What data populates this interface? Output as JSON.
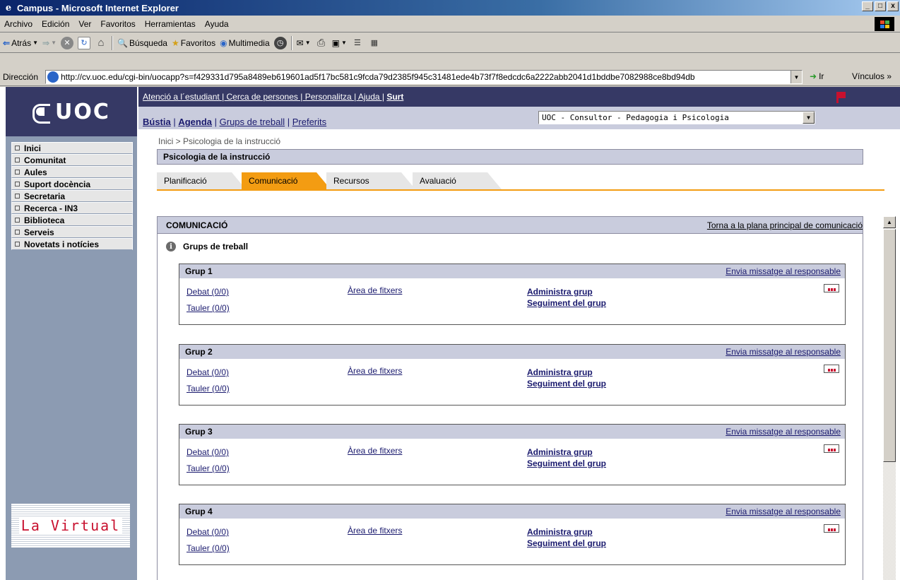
{
  "window": {
    "title": "Campus - Microsoft Internet Explorer",
    "controls": [
      "_",
      "□",
      "x"
    ]
  },
  "menu": [
    "Archivo",
    "Edición",
    "Ver",
    "Favoritos",
    "Herramientas",
    "Ayuda"
  ],
  "toolbar": {
    "back": "Atrás",
    "search": "Búsqueda",
    "favorites": "Favoritos",
    "multimedia": "Multimedia"
  },
  "address": {
    "label": "Dirección",
    "url": "http://cv.uoc.edu/cgi-bin/uocapp?s=f429331d795a8489eb619601ad5f17bc581c9fcda79d2385f945c31481ede4b73f7f8edcdc6a2222abb2041d1bddbe7082988ce8bd94db",
    "go": "Ir",
    "links": "Vínculos"
  },
  "site": {
    "logo": "UOC",
    "top_links": "Atenció a l´estudiant | Cerca de persones | Personalitza | Ajuda |",
    "top_exit": "Surt",
    "sub_bustia": "Bústia",
    "sub_agenda": "Agenda",
    "sub_grups": "Grups de treball",
    "sub_preferits": "Preferits",
    "consultor": "UOC - Consultor - Pedagogia i Psicologia",
    "nav": [
      "Inici",
      "Comunitat",
      "Aules",
      "Suport docència",
      "Secretaria",
      "Recerca - IN3",
      "Biblioteca",
      "Serveis",
      "Novetats i notícies"
    ],
    "lavirtual": "La Virtual"
  },
  "content": {
    "breadcrumb": "Inici  > Psicologia de la instrucció",
    "course_title": "Psicologia de la instrucció",
    "tabs": [
      "Planificació",
      "Comunicació",
      "Recursos",
      "Avaluació"
    ],
    "active_tab": "Comunicació",
    "section_title": "COMUNICACIÓ",
    "back_link": "Torna a la plana principal de comunicació",
    "grups_title": "Grups de treball",
    "groups": [
      {
        "name": "Grup 1",
        "msg": "Envia missatge al responsable",
        "debat": "Debat (0/0)",
        "tauler": "Tauler (0/0)",
        "area": "Àrea de fitxers",
        "admin": "Administra grup",
        "seguiment": "Seguiment del grup"
      },
      {
        "name": "Grup 2",
        "msg": "Envia missatge al responsable",
        "debat": "Debat (0/0)",
        "tauler": "Tauler (0/0)",
        "area": "Àrea de fitxers",
        "admin": "Administra grup",
        "seguiment": "Seguiment del grup"
      },
      {
        "name": "Grup 3",
        "msg": "Envia missatge al responsable",
        "debat": "Debat (0/0)",
        "tauler": "Tauler (0/0)",
        "area": "Àrea de fitxers",
        "admin": "Administra grup",
        "seguiment": "Seguiment del grup"
      },
      {
        "name": "Grup 4",
        "msg": "Envia missatge al responsable",
        "debat": "Debat (0/0)",
        "tauler": "Tauler (0/0)",
        "area": "Àrea de fitxers",
        "admin": "Administra grup",
        "seguiment": "Seguiment del grup"
      }
    ]
  },
  "colors": {
    "accent_orange": "#f39c12",
    "nav_dark": "#363965",
    "panel_lavender": "#c9ccdd",
    "sidebar_bg": "#8c9bb2"
  }
}
